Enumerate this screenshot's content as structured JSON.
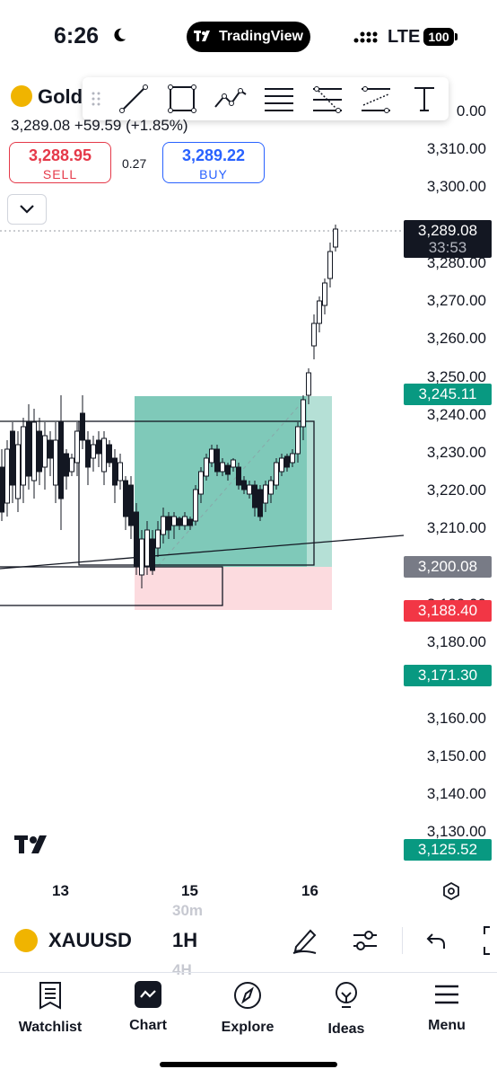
{
  "status_bar": {
    "time": "6:26",
    "app_pill": "TradingView",
    "network": "LTE",
    "battery": "100"
  },
  "symbol_header": {
    "name": "Gold",
    "price": "3,289.08",
    "change": "+59.59 (+1.85%)",
    "sell": {
      "price": "3,288.95",
      "label": "SELL"
    },
    "spread": "0.27",
    "buy": {
      "price": "3,289.22",
      "label": "BUY"
    }
  },
  "drawing_toolbar": {
    "tools": [
      "trend-line-icon",
      "rectangle-icon",
      "path-icon",
      "horizontal-lines-icon",
      "fib-lines-icon",
      "parallel-channel-icon",
      "text-icon"
    ]
  },
  "price_axis": {
    "labels": [
      "3,310.00",
      "3,300.00",
      "3,280.00",
      "3,270.00",
      "3,260.00",
      "3,250.00",
      "3,240.00",
      "3,230.00",
      "3,220.00",
      "3,210.00",
      "3,180.00",
      "3,160.00",
      "3,150.00",
      "3,140.00",
      "3,130.00"
    ],
    "partial_top": "0.00",
    "partial_mid": "3,190.00",
    "tags": {
      "current": "3,289.08",
      "countdown": "33:53",
      "target": "3,245.11",
      "entry": "3,200.08",
      "stop": "3,188.40",
      "level_green": "3,171.30",
      "level_green_low": "3,125.52"
    },
    "colors": {
      "green": "#089981",
      "red": "#f23645",
      "grey": "#787b86",
      "black": "#131722"
    }
  },
  "time_axis": {
    "labels": [
      "13",
      "15",
      "16"
    ]
  },
  "symbol_bar": {
    "symbol": "XAUUSD",
    "timeframe": "1H",
    "timeframe_above": "30m",
    "timeframe_below": "4H"
  },
  "bottom_nav": {
    "items": [
      {
        "label": "Watchlist",
        "icon": "watchlist-icon"
      },
      {
        "label": "Chart",
        "icon": "chart-icon"
      },
      {
        "label": "Explore",
        "icon": "compass-icon"
      },
      {
        "label": "Ideas",
        "icon": "lightbulb-icon"
      },
      {
        "label": "Menu",
        "icon": "menu-icon"
      }
    ]
  }
}
